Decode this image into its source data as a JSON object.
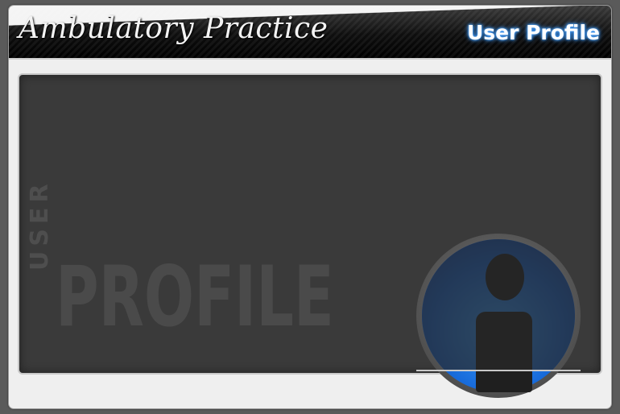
{
  "header": {
    "app_title": "Ambulatory Practice",
    "page_title": "User Profile"
  },
  "panel": {
    "watermark_vertical": "USER",
    "watermark_large": "PROFILE"
  },
  "avatar": {
    "icon": "user-silhouette-icon"
  },
  "colors": {
    "header_background": "#0f0f0f",
    "title_glow": "#2a7fdf",
    "panel_background": "#3a3a3a",
    "frame_background": "#efefef",
    "avatar_ring": "#1668d8"
  }
}
